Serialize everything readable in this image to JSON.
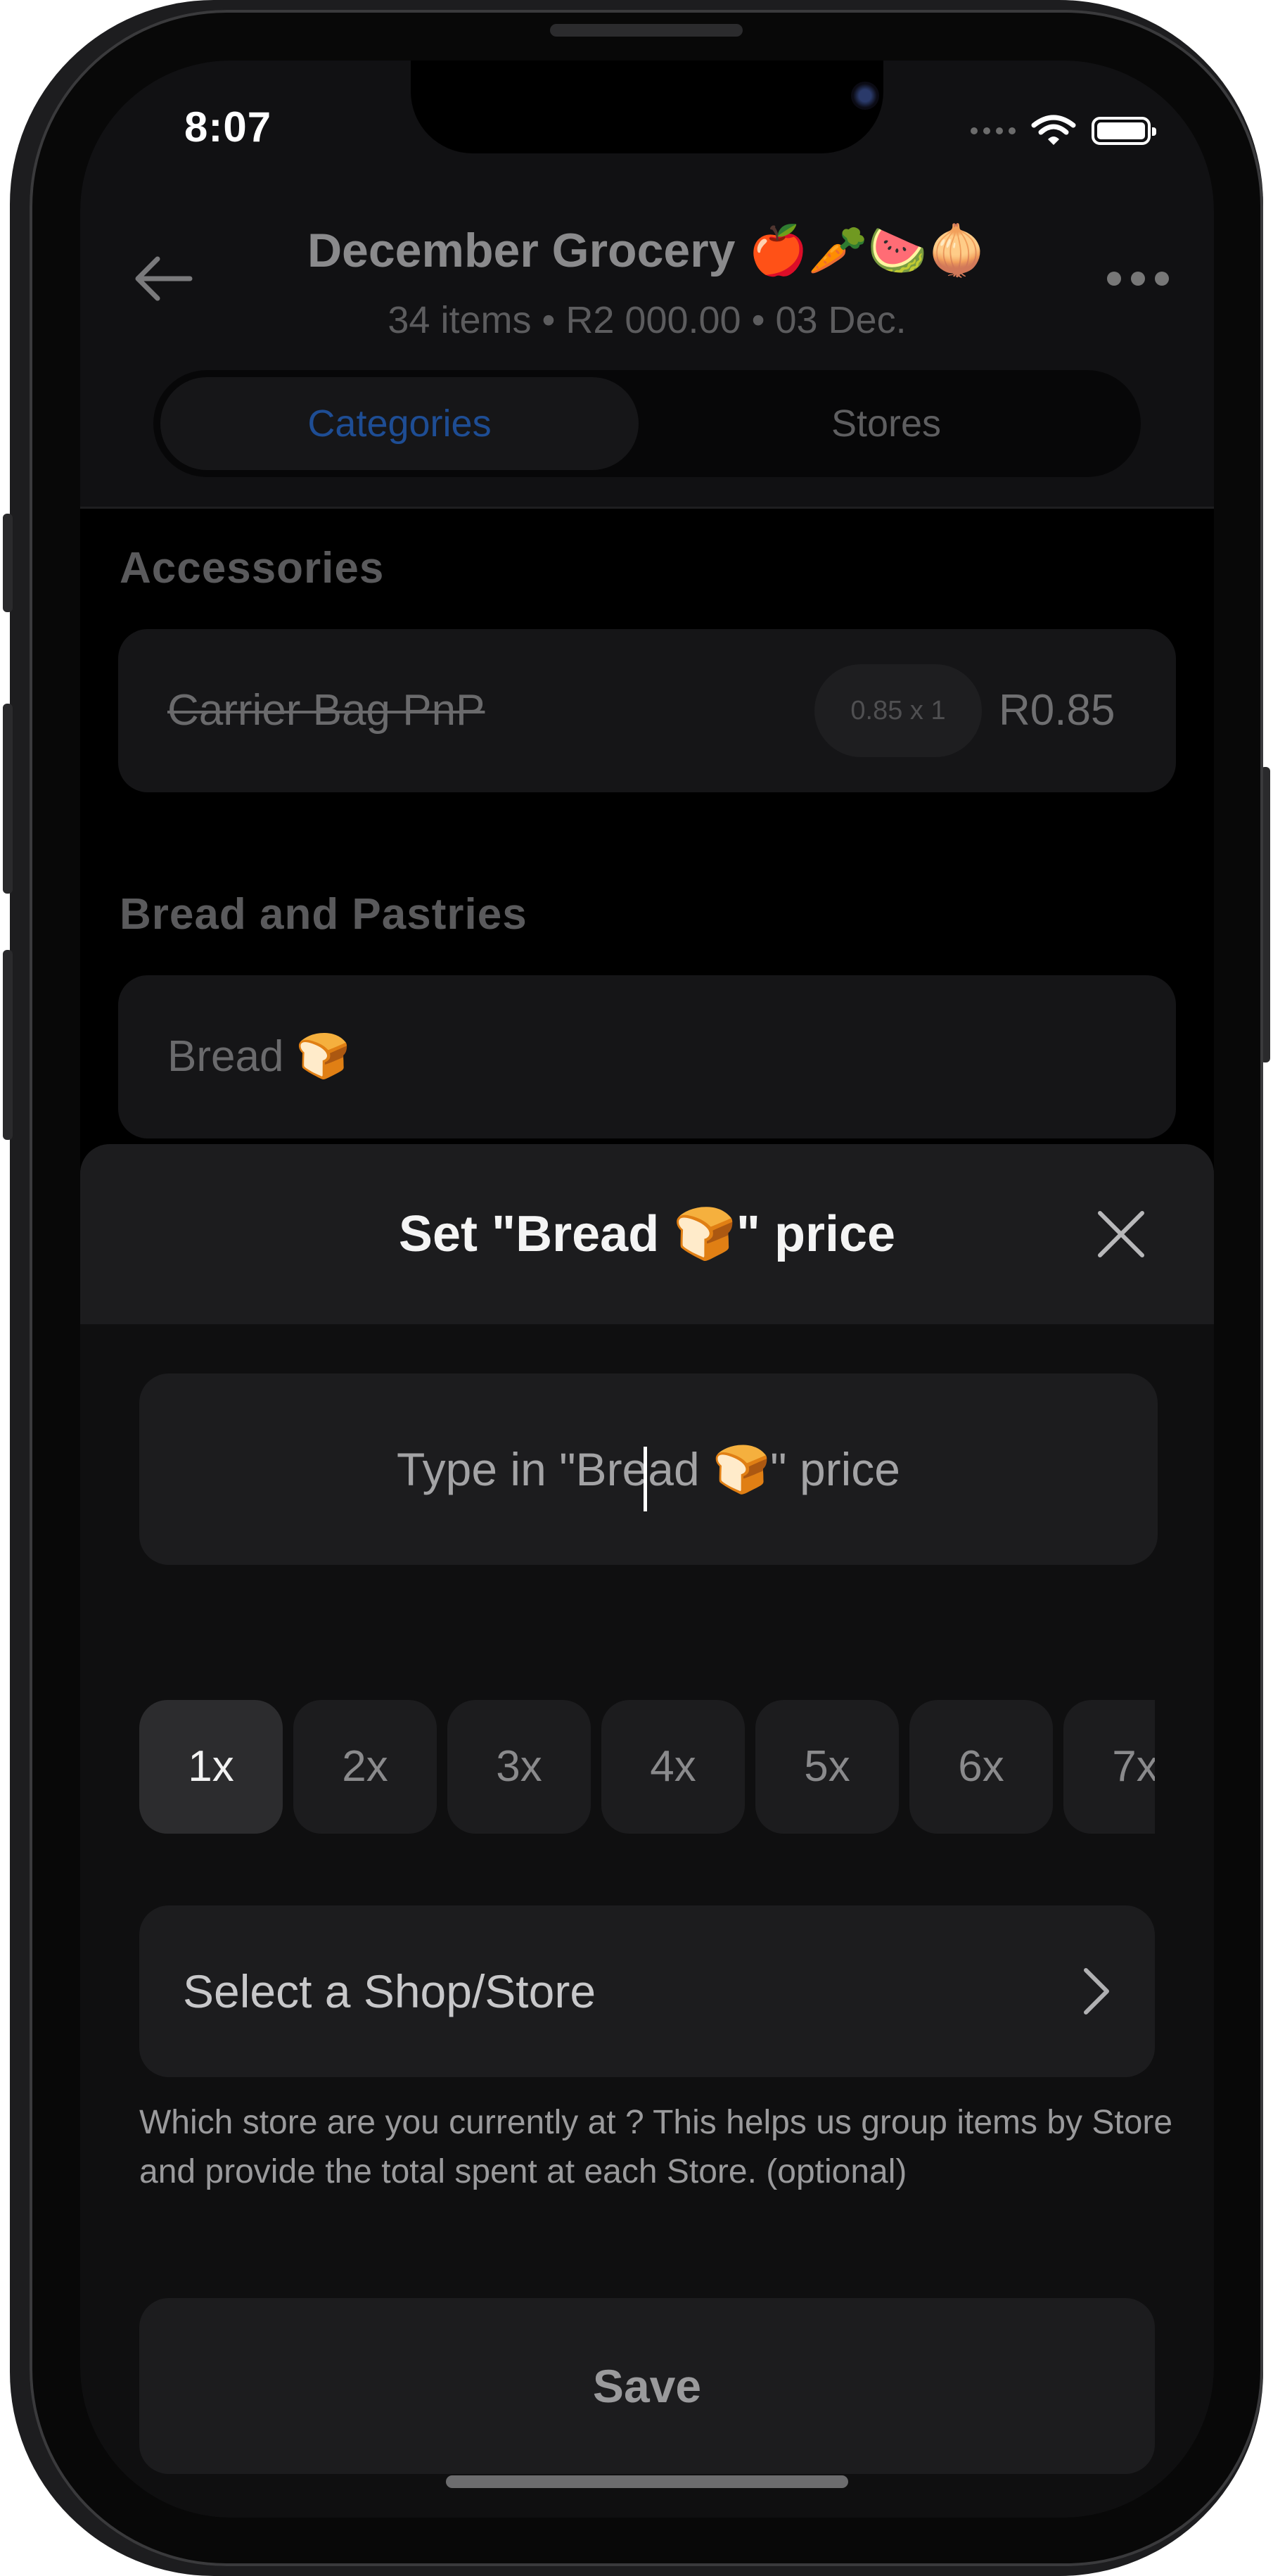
{
  "status_bar": {
    "time": "8:07"
  },
  "header": {
    "title": "December Grocery 🍎🥕🍉🧅",
    "subtitle": "34 items • R2 000.00 • 03 Dec.",
    "tabs": [
      {
        "label": "Categories",
        "active": true
      },
      {
        "label": "Stores",
        "active": false
      }
    ]
  },
  "sections": [
    {
      "title": "Accessories",
      "items": [
        {
          "name": "Carrier Bag PnP",
          "quantity": "0.85 x 1",
          "price": "R0.85",
          "checked": true
        }
      ]
    },
    {
      "title": "Bread and Pastries",
      "items": [
        {
          "name": "Bread 🍞"
        }
      ]
    }
  ],
  "sheet": {
    "title": "Set \"Bread 🍞\" price",
    "price_placeholder": "Type in \"Bread 🍞\" price",
    "multipliers": [
      "1x",
      "2x",
      "3x",
      "4x",
      "5x",
      "6x",
      "7x"
    ],
    "selected_multiplier": "1x",
    "store_label": "Select a Shop/Store",
    "store_helper": "Which store are you currently at ? This helps us group items by Store and provide the total spent at each Store. (optional)",
    "save_label": "Save"
  },
  "colors": {
    "background": "#000000",
    "sheet": "#0f0f10",
    "card": "#1c1c1e",
    "active_tab": "#1e4d94"
  },
  "icons": [
    "back-arrow-icon",
    "more-icon",
    "close-icon",
    "chevron-right-icon",
    "wifi-icon",
    "battery-icon",
    "cellular-icon"
  ]
}
